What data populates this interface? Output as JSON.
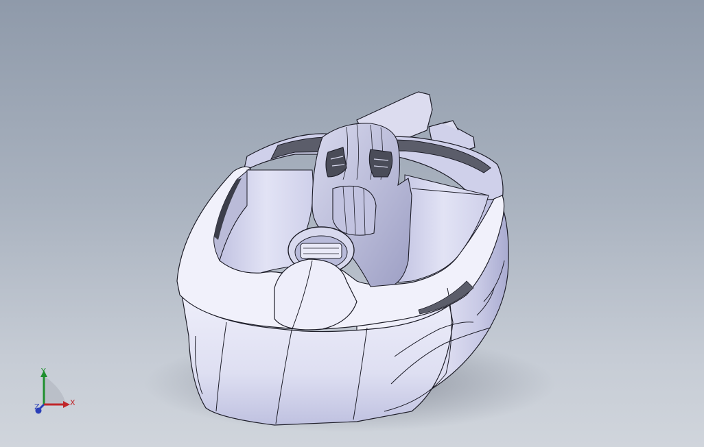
{
  "viewport": {
    "background_top": "#8f9aaa",
    "background_bottom": "#d0d5dc",
    "model_color": "#e6e7f7",
    "edge_color": "#1d1d28"
  },
  "triad": {
    "x_label": "X",
    "y_label": "Y",
    "z_label": "Z",
    "x_color": "#c0262a",
    "y_color": "#1f8f2e",
    "z_color": "#2a3fb8",
    "icon": "coordinate-triad-icon"
  }
}
